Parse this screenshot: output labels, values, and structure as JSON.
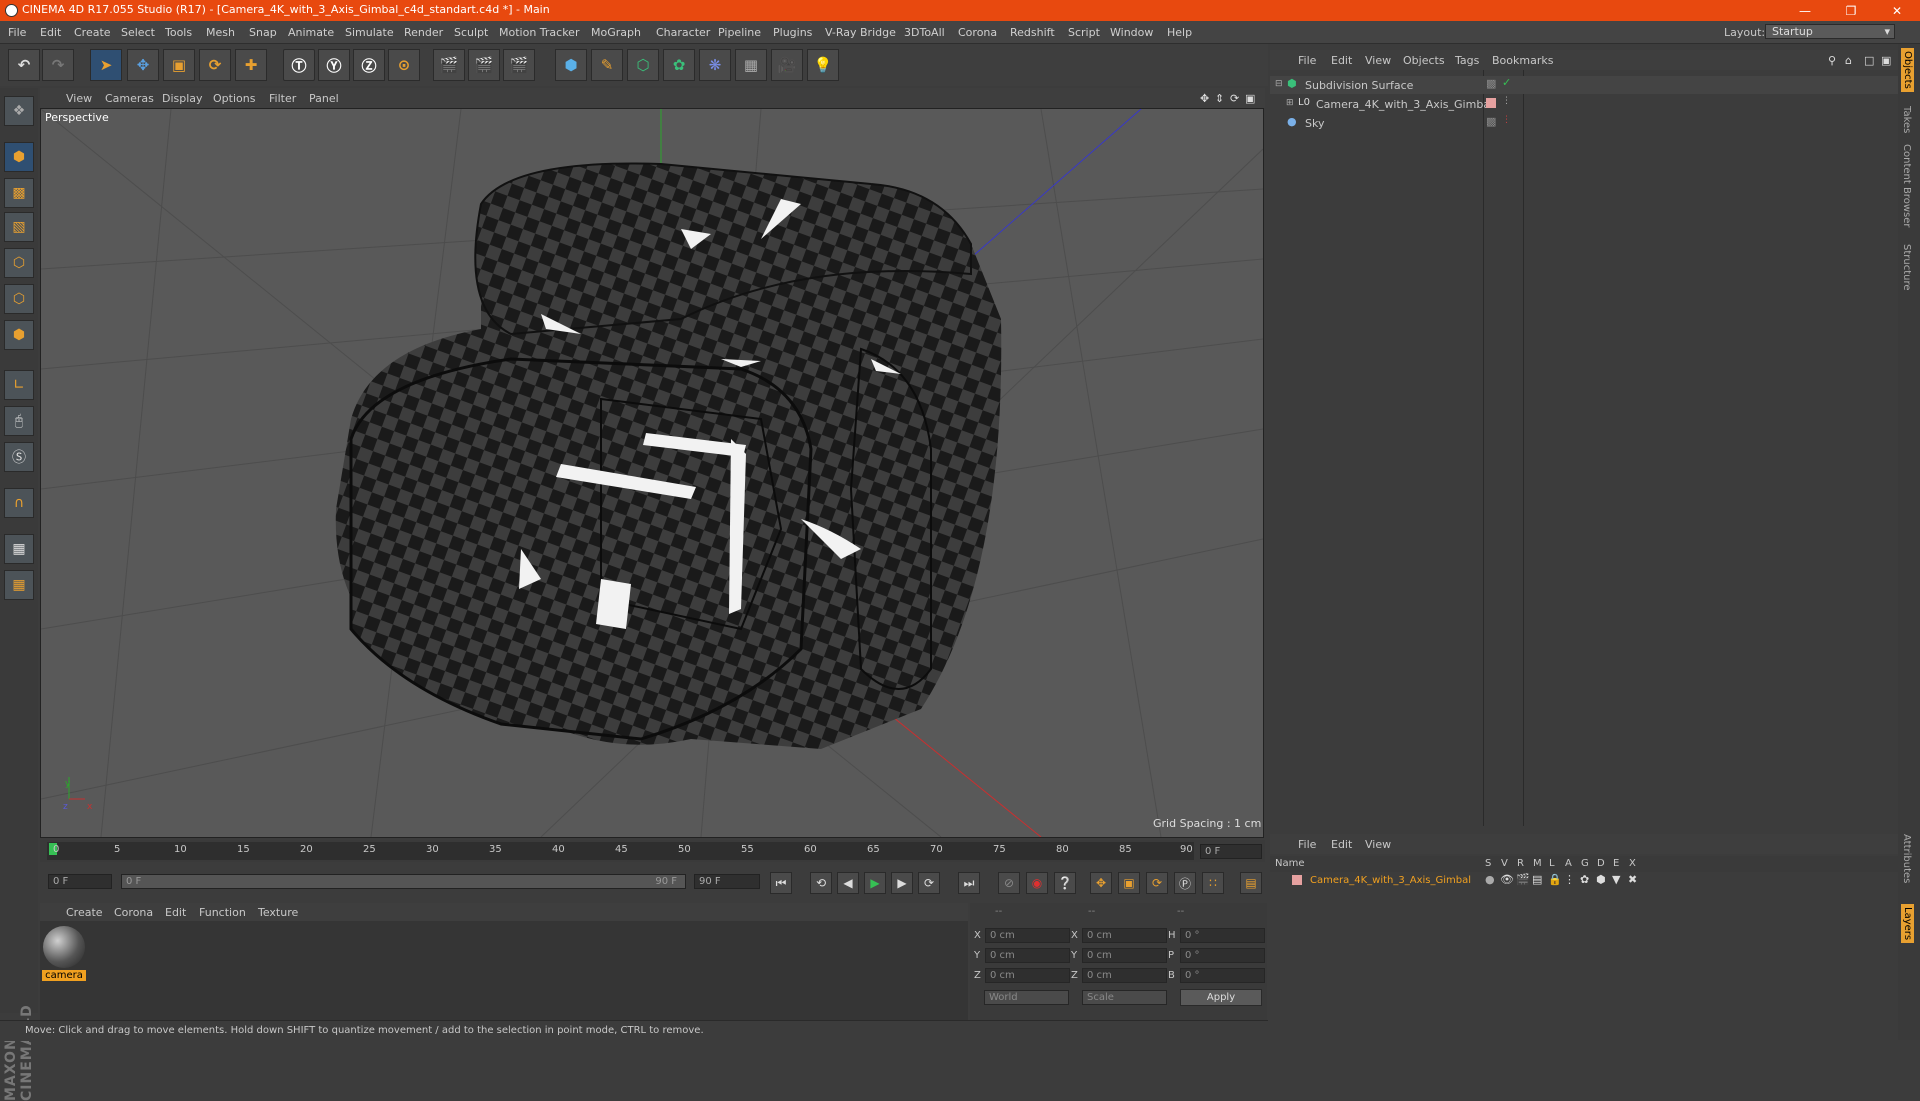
{
  "title_bar": {
    "text": "CINEMA 4D R17.055 Studio (R17) - [Camera_4K_with_3_Axis_Gimbal_c4d_standart.c4d *] - Main"
  },
  "menu": [
    "File",
    "Edit",
    "Create",
    "Select",
    "Tools",
    "Mesh",
    "Snap",
    "Animate",
    "Simulate",
    "Render",
    "Sculpt",
    "Motion Tracker",
    "MoGraph",
    "Character",
    "Pipeline",
    "Plugins",
    "V-Ray Bridge",
    "3DToAll",
    "Corona",
    "Redshift",
    "Script",
    "Window",
    "Help"
  ],
  "layout": {
    "label": "Layout:",
    "value": "Startup"
  },
  "viewport": {
    "menu": [
      "View",
      "Cameras",
      "Display",
      "Options",
      "Filter",
      "Panel"
    ],
    "label": "Perspective",
    "grid_spacing": "Grid Spacing : 1 cm",
    "axis": {
      "y": "y",
      "x": "x",
      "z": "z"
    }
  },
  "timeline": {
    "ticks": [
      "0",
      "5",
      "10",
      "15",
      "20",
      "25",
      "30",
      "35",
      "40",
      "45",
      "50",
      "55",
      "60",
      "65",
      "70",
      "75",
      "80",
      "85",
      "90"
    ],
    "end_frame_field": "0 F"
  },
  "transport": {
    "start": "0 F",
    "range_start": "0 F",
    "range_end": "90 F",
    "end": "90 F"
  },
  "material_manager": {
    "menu": [
      "Create",
      "Corona",
      "Edit",
      "Function",
      "Texture"
    ],
    "materials": [
      {
        "name": "camera"
      }
    ]
  },
  "coordinates": {
    "headers": [
      "--",
      "--",
      "--"
    ],
    "rows": [
      {
        "a": "X",
        "av": "0 cm",
        "b": "X",
        "bv": "0 cm",
        "c": "H",
        "cv": "0 °"
      },
      {
        "a": "Y",
        "av": "0 cm",
        "b": "Y",
        "bv": "0 cm",
        "c": "P",
        "cv": "0 °"
      },
      {
        "a": "Z",
        "av": "0 cm",
        "b": "Z",
        "bv": "0 cm",
        "c": "B",
        "cv": "0 °"
      }
    ],
    "mode": "World",
    "scale": "Scale",
    "apply": "Apply"
  },
  "status_bar": "Move: Click and drag to move elements. Hold down SHIFT to quantize movement / add to the selection in point mode, CTRL to remove.",
  "object_manager": {
    "menu": [
      "File",
      "Edit",
      "View",
      "Objects",
      "Tags",
      "Bookmarks"
    ],
    "objects": [
      {
        "name": "Subdivision Surface"
      },
      {
        "name": "Camera_4K_with_3_Axis_Gimbal"
      },
      {
        "name": "Sky"
      }
    ]
  },
  "layer_manager": {
    "menu": [
      "File",
      "Edit",
      "View"
    ],
    "columns": {
      "name": "Name",
      "flags": [
        "S",
        "V",
        "R",
        "M",
        "L",
        "A",
        "G",
        "D",
        "E",
        "X"
      ]
    },
    "layers": [
      {
        "name": "Camera_4K_with_3_Axis_Gimbal",
        "color": "#e6a1a0"
      }
    ]
  },
  "side_tabs": {
    "top": [
      "Objects",
      "Takes",
      "Content Browser",
      "Structure"
    ],
    "bottom": [
      "Attributes",
      "Layers"
    ]
  },
  "brand": "MAXON CINEMA 4D",
  "colors": {
    "title_bar": "#e8490f",
    "accent_blue": "#2f4f72",
    "layer_name": "#f0a020"
  }
}
